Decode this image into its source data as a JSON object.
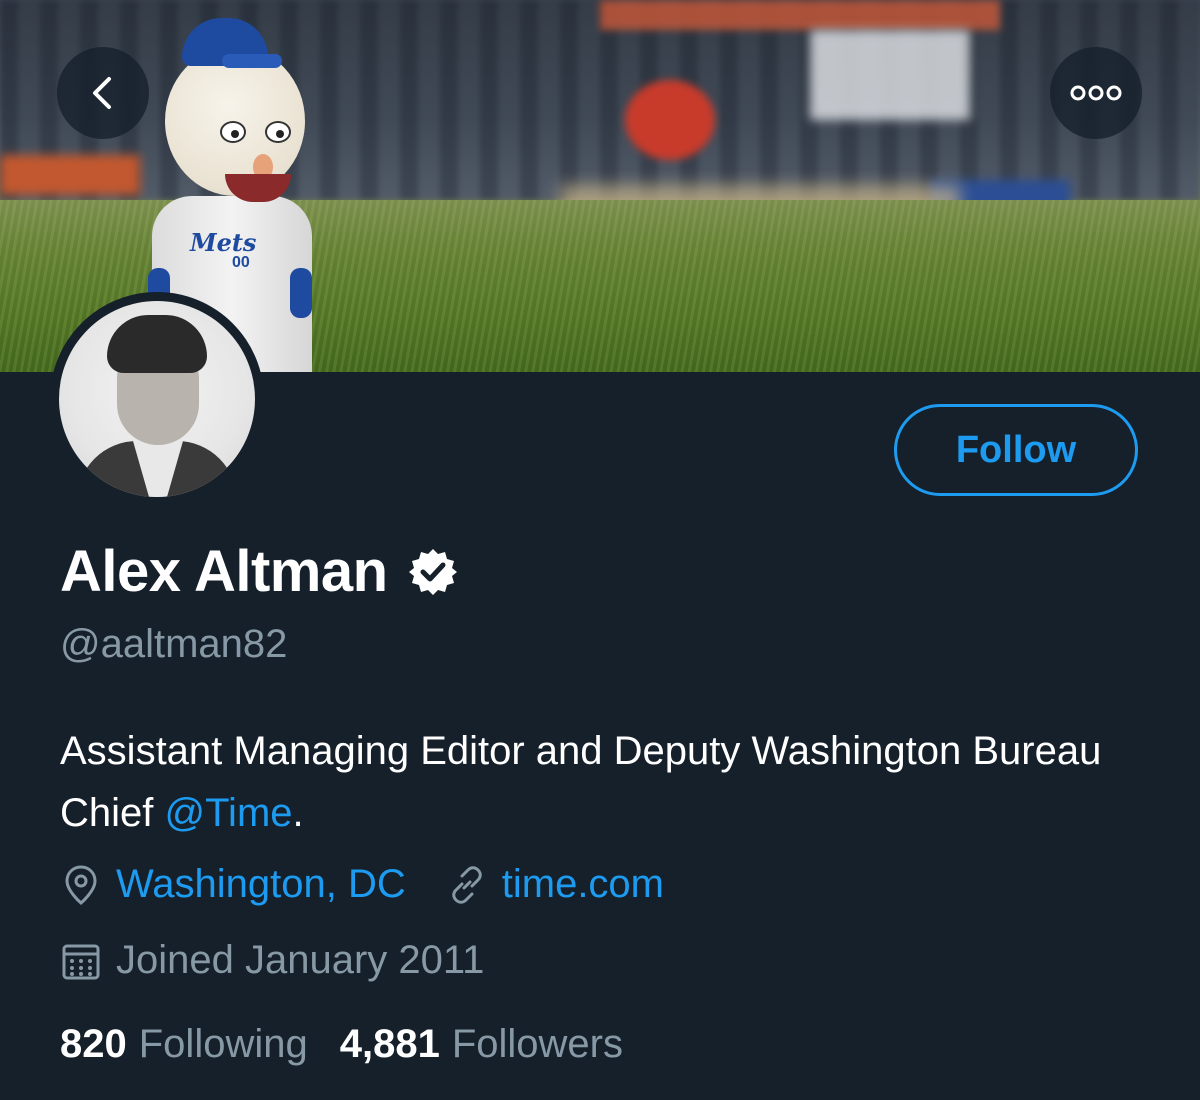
{
  "profile": {
    "name": "Alex Altman",
    "handle": "@aaltman82",
    "bio_text": "Assistant Managing Editor and Deputy Washington Bureau Chief ",
    "bio_mention": "@Time",
    "bio_end": ".",
    "location": "Washington, DC",
    "website": "time.com",
    "joined": "Joined January 2011"
  },
  "banner": {
    "jersey_text": "Mets",
    "jersey_number": "00"
  },
  "actions": {
    "follow_label": "Follow"
  },
  "stats": {
    "following_count": "820",
    "following_label": "Following",
    "followers_count": "4,881",
    "followers_label": "Followers"
  },
  "icons": {
    "back": "chevron-left-icon",
    "more": "more-horizontal-icon",
    "verified": "verified-badge-icon",
    "location": "location-pin-icon",
    "link": "link-icon",
    "calendar": "calendar-icon"
  },
  "colors": {
    "background": "#15202b",
    "accent": "#1d9bf0",
    "secondary_text": "#8899a6",
    "primary_text": "#ffffff"
  }
}
